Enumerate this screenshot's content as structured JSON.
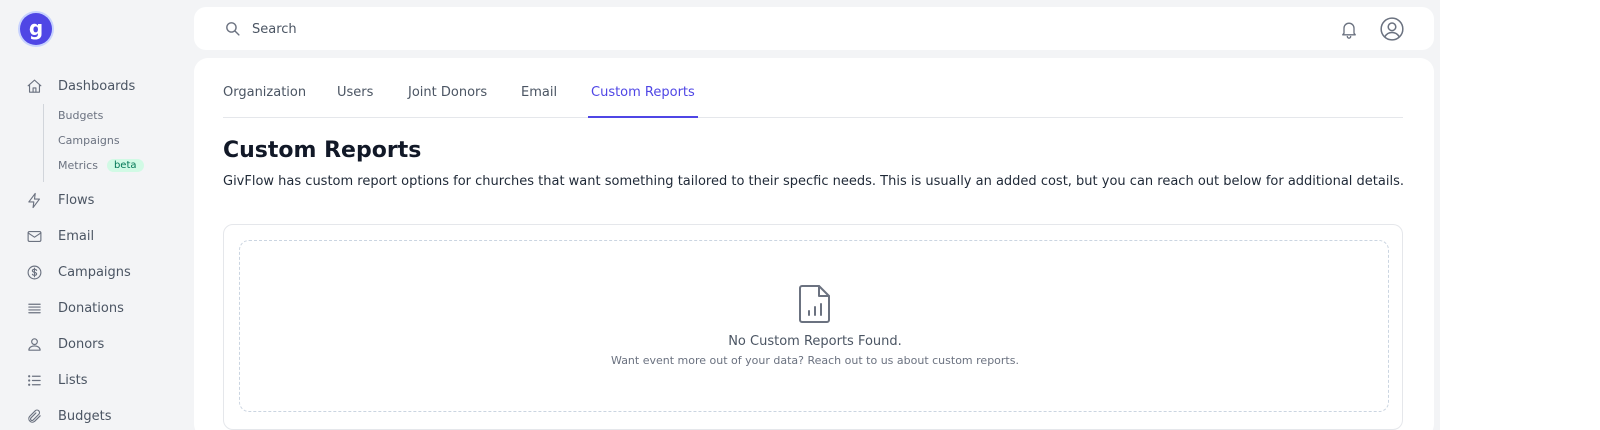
{
  "sidebar": {
    "logo_letter": "g",
    "items": [
      {
        "label": "Dashboards",
        "icon": "home-icon"
      },
      {
        "label": "Flows",
        "icon": "bolt-icon"
      },
      {
        "label": "Email",
        "icon": "envelope-icon"
      },
      {
        "label": "Campaigns",
        "icon": "dollar-circle-icon"
      },
      {
        "label": "Donations",
        "icon": "bars-icon"
      },
      {
        "label": "Donors",
        "icon": "users-icon"
      },
      {
        "label": "Lists",
        "icon": "list-icon"
      },
      {
        "label": "Budgets",
        "icon": "paperclip-icon"
      }
    ],
    "sub_items": [
      {
        "label": "Budgets"
      },
      {
        "label": "Campaigns"
      },
      {
        "label": "Metrics",
        "badge": "beta"
      }
    ]
  },
  "search": {
    "placeholder": "Search"
  },
  "tabs": [
    {
      "label": "Organization"
    },
    {
      "label": "Users"
    },
    {
      "label": "Joint Donors"
    },
    {
      "label": "Email"
    },
    {
      "label": "Custom Reports",
      "active": true
    }
  ],
  "page": {
    "title": "Custom Reports",
    "description": "GivFlow has custom report options for churches that want something tailored to their specfic needs. This is usually an added cost, but you can reach out below for additional details."
  },
  "empty_state": {
    "icon": "document-chart-icon",
    "title": "No Custom Reports Found.",
    "subtitle": "Want event more out of your data? Reach out to us about custom reports."
  },
  "colors": {
    "accent": "#4f46e5",
    "badge_bg": "#d1fae5",
    "badge_text": "#047857"
  }
}
